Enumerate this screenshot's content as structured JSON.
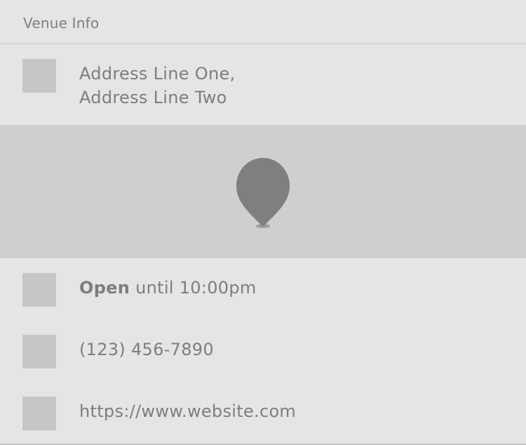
{
  "header": {
    "title": "Venue Info"
  },
  "address": {
    "icon": "location-icon",
    "line1": "Address Line One,",
    "line2": "Address Line Two"
  },
  "map": {
    "icon": "map-pin-icon"
  },
  "hours": {
    "icon": "clock-icon",
    "status": "Open",
    "detail": "until 10:00pm"
  },
  "phone": {
    "icon": "phone-icon",
    "number": "(123) 456-7890"
  },
  "website": {
    "icon": "globe-icon",
    "url": "https://www.website.com"
  },
  "colors": {
    "background": "#e5e5e5",
    "map_background": "#cfcfcf",
    "pin": "#7f7f7f",
    "icon_placeholder": "#c6c6c6",
    "text": "#7e7e7e",
    "divider": "#c4c4c4"
  }
}
